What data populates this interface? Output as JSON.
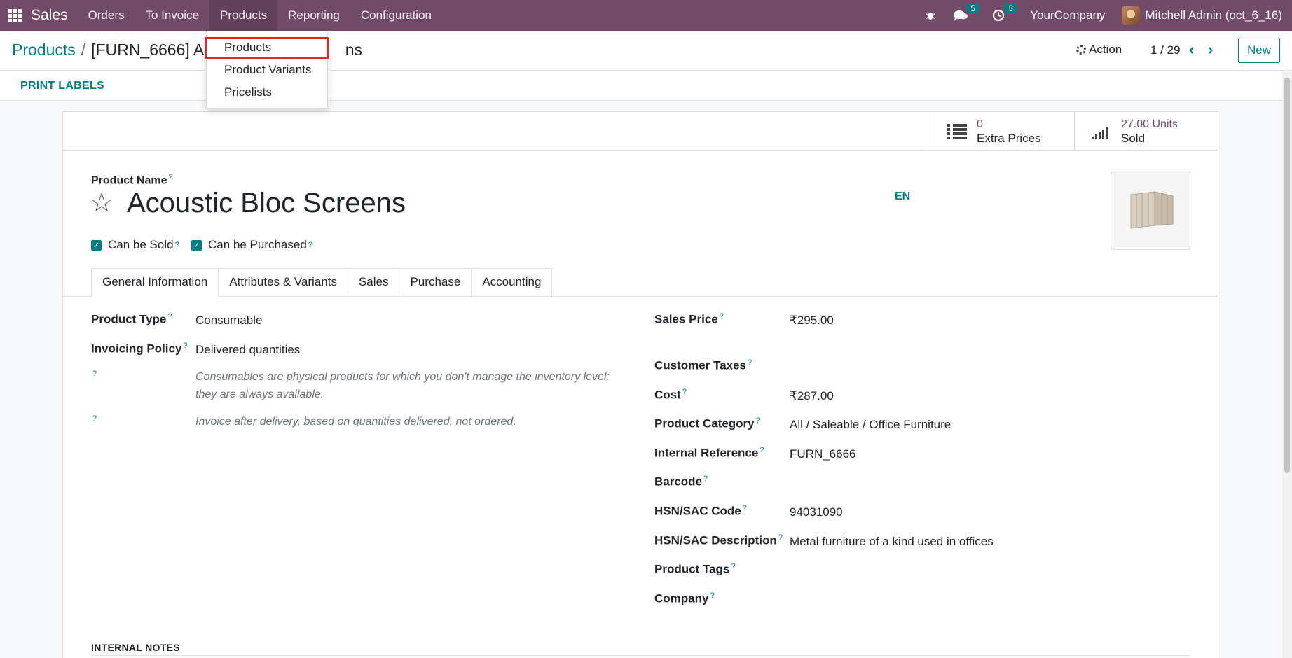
{
  "navbar": {
    "brand": "Sales",
    "menus": [
      "Orders",
      "To Invoice",
      "Products",
      "Reporting",
      "Configuration"
    ],
    "messages_count": "5",
    "activities_count": "3",
    "company": "YourCompany",
    "user": "Mitchell Admin (oct_6_16)"
  },
  "control": {
    "breadcrumb_parent": "Products",
    "breadcrumb_current_visible_start": "[FURN_6666] Ac",
    "breadcrumb_current_visible_end": "ns",
    "action_label": "Action",
    "pager": "1 / 29",
    "new_label": "New"
  },
  "statusbar": {
    "print_labels": "PRINT LABELS"
  },
  "dropdown": {
    "items": [
      "Products",
      "Product Variants",
      "Pricelists"
    ]
  },
  "stat_buttons": [
    {
      "value": "0",
      "label": "Extra Prices",
      "icon": "list-icon"
    },
    {
      "value": "27.00 Units",
      "label": "Sold",
      "icon": "signal-bars-icon"
    }
  ],
  "form": {
    "product_name_label": "Product Name",
    "product_name": "Acoustic Bloc Screens",
    "lang": "EN",
    "can_be_sold": "Can be Sold",
    "can_be_purchased": "Can be Purchased",
    "tabs": [
      "General Information",
      "Attributes & Variants",
      "Sales",
      "Purchase",
      "Accounting"
    ],
    "left": {
      "product_type_label": "Product Type",
      "product_type": "Consumable",
      "invoicing_policy_label": "Invoicing Policy",
      "invoicing_policy": "Delivered quantities",
      "help_type": "Consumables are physical products for which you don't manage the inventory level: they are always available.",
      "help_invoice": "Invoice after delivery, based on quantities delivered, not ordered."
    },
    "right": {
      "sales_price_label": "Sales Price",
      "sales_price": "₹295.00",
      "customer_taxes_label": "Customer Taxes",
      "cost_label": "Cost",
      "cost": "₹287.00",
      "category_label": "Product Category",
      "category": "All / Saleable / Office Furniture",
      "internal_ref_label": "Internal Reference",
      "internal_ref": "FURN_6666",
      "barcode_label": "Barcode",
      "hsn_code_label": "HSN/SAC Code",
      "hsn_code": "94031090",
      "hsn_desc_label": "HSN/SAC Description",
      "hsn_desc": "Metal furniture of a kind used in offices",
      "tags_label": "Product Tags",
      "company_label": "Company"
    },
    "internal_notes": "INTERNAL NOTES"
  },
  "colors": {
    "brand": "#714b67",
    "accent": "#017e84",
    "highlight": "#e32626"
  }
}
